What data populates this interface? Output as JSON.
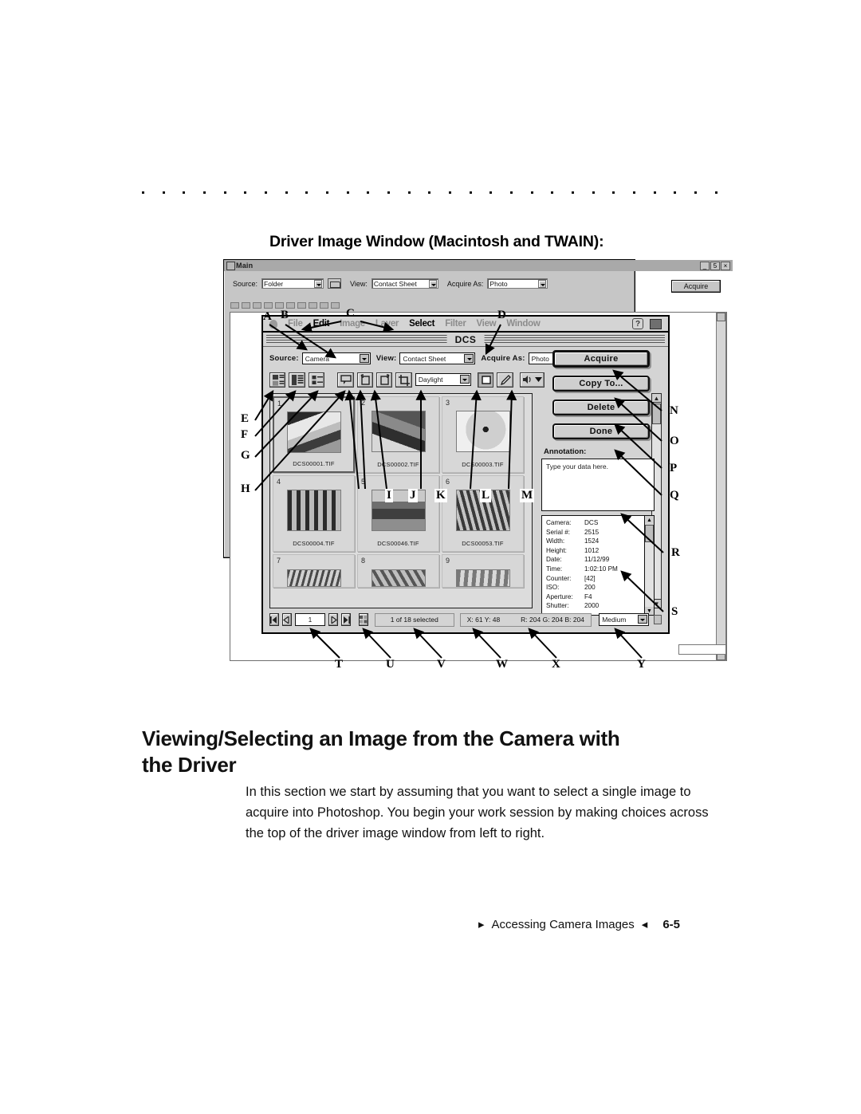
{
  "page": {
    "section_title": "Driver Image Window (Macintosh and TWAIN):",
    "heading": "Viewing/Selecting an Image from the Camera with the Driver",
    "body": "In this section we start by assuming that you want to select a single image to acquire into Photoshop. You begin your work session by making choices across the top of the driver image window from left to right.",
    "footer_mark_left": "▸",
    "footer_text": "Accessing Camera Images",
    "footer_mark_right": "◂",
    "page_number": "6-5",
    "rule_dot_count": 29
  },
  "background_window": {
    "title": "Main",
    "minimize": "_",
    "restore": "5",
    "close": "×",
    "source_label": "Source:",
    "source_value": "Folder",
    "folder_icon": "open-folder-icon",
    "view_label": "View:",
    "view_value": "Contact Sheet",
    "acquire_as_label": "Acquire As:",
    "acquire_as_value": "Photo",
    "acquire_button": "Acquire"
  },
  "mac_window": {
    "title": "DCS",
    "menu": [
      {
        "label": "File",
        "active": false
      },
      {
        "label": "Edit",
        "active": true
      },
      {
        "label": "Image",
        "active": false
      },
      {
        "label": "Layer",
        "active": false
      },
      {
        "label": "Select",
        "active": true
      },
      {
        "label": "Filter",
        "active": false
      },
      {
        "label": "View",
        "active": false
      },
      {
        "label": "Window",
        "active": false
      }
    ],
    "menu_right_icons": [
      "help-question-icon",
      "image-preview-icon"
    ],
    "controls": {
      "source_label": "Source:",
      "source_value": "Camera",
      "view_label": "View:",
      "view_value": "Contact Sheet",
      "acquire_as_label": "Acquire As:",
      "acquire_as_value": "Photo",
      "white_balance_value": "Daylight"
    },
    "toolbar_icons": [
      "contact-sheet-view-icon",
      "detail-list-view-icon",
      "image-info-icon",
      "tag-annotation-icon",
      "rotate-left-icon",
      "rotate-right-icon",
      "crop-icon",
      "selection-tool-icon",
      "eyedropper-tool-icon",
      "sound-playback-icon"
    ],
    "buttons": {
      "acquire": "Acquire",
      "copy_to": "Copy To...",
      "delete": "Delete",
      "done": "Done"
    },
    "annotation": {
      "label": "Annotation:",
      "value": "Type your data here."
    },
    "metadata": [
      {
        "key": "Camera:",
        "value": "DCS"
      },
      {
        "key": "Serial #:",
        "value": "2515"
      },
      {
        "key": "Width:",
        "value": "1524"
      },
      {
        "key": "Height:",
        "value": "1012"
      },
      {
        "key": "Date:",
        "value": "11/12/99"
      },
      {
        "key": "Time:",
        "value": "1:02:10 PM"
      },
      {
        "key": "Counter:",
        "value": "[42]"
      },
      {
        "key": "ISO:",
        "value": "200"
      },
      {
        "key": "Aperture:",
        "value": "F4"
      },
      {
        "key": "Shutter:",
        "value": "2000"
      }
    ],
    "thumbnails": [
      {
        "num": "1",
        "file": "DCS00001.TIF",
        "selected": true
      },
      {
        "num": "2",
        "file": "DCS00002.TIF",
        "selected": false
      },
      {
        "num": "3",
        "file": "DCS00003.TIF",
        "selected": false
      },
      {
        "num": "4",
        "file": "DCS00004.TIF",
        "selected": false
      },
      {
        "num": "5",
        "file": "DCS00046.TIF",
        "selected": false
      },
      {
        "num": "6",
        "file": "DCS00053.TIF",
        "selected": false
      },
      {
        "num": "7",
        "file": "",
        "selected": false
      },
      {
        "num": "8",
        "file": "",
        "selected": false
      },
      {
        "num": "9",
        "file": "",
        "selected": false
      }
    ],
    "status_bar": {
      "first_icon": "first-page-icon",
      "prev_icon": "previous-page-icon",
      "page_value": "1",
      "next_icon": "next-page-icon",
      "last_icon": "last-page-icon",
      "grid_icon": "grid-layout-icon",
      "selection_text": "1 of 18 selected",
      "coords_text": "X: 61 Y: 48",
      "rgb_text": "R: 204 G: 204 B: 204",
      "size_value": "Medium"
    }
  },
  "callouts": {
    "top": [
      "A",
      "B",
      "C",
      "D"
    ],
    "left": [
      "E",
      "F",
      "G",
      "H"
    ],
    "middle": [
      "I",
      "J",
      "K",
      "L",
      "M"
    ],
    "right": [
      "N",
      "O",
      "P",
      "Q",
      "R",
      "S"
    ],
    "bottom": [
      "T",
      "U",
      "V",
      "W",
      "X",
      "Y"
    ]
  }
}
